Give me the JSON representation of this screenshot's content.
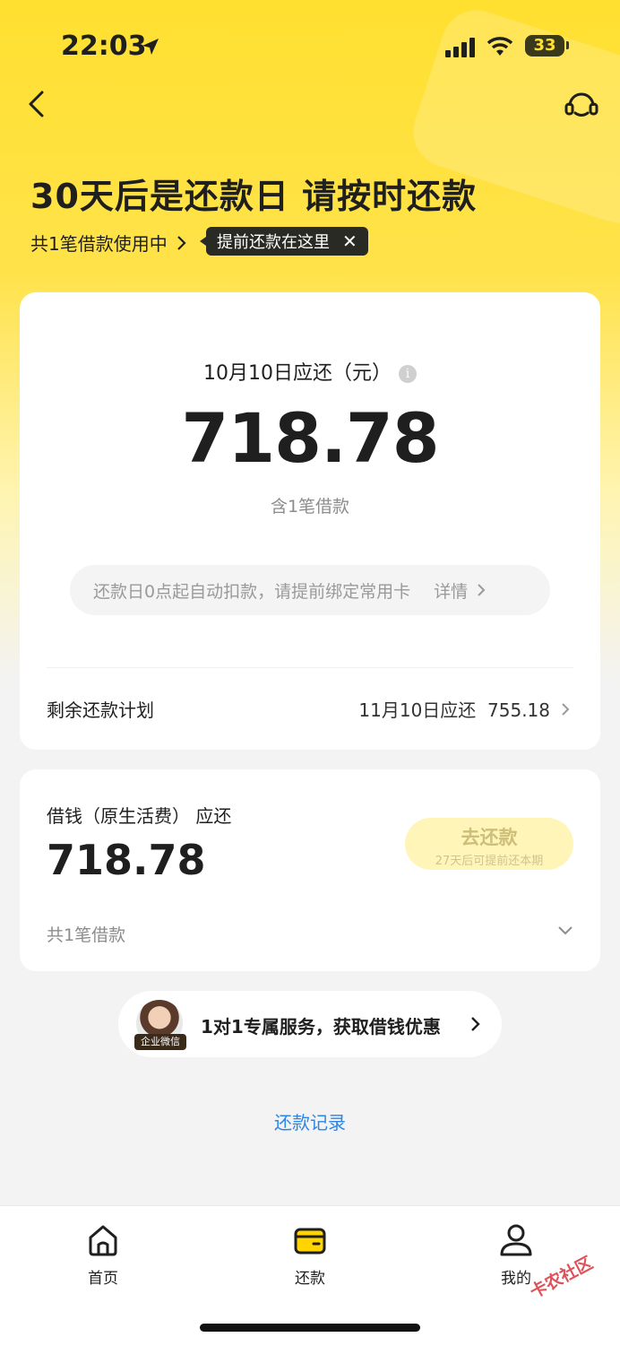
{
  "status_bar": {
    "time": "22:03",
    "battery": "33"
  },
  "header": {
    "headline": "30天后是还款日 请按时还款",
    "loan_count": "共1笔借款使用中",
    "tip": "提前还款在这里"
  },
  "due_card": {
    "label": "10月10日应还（元）",
    "amount": "718.78",
    "sub": "含1笔借款",
    "notice": "还款日0点起自动扣款，请提前绑定常用卡",
    "notice_detail": "详情",
    "plan_label": "剩余还款计划",
    "plan_value": "11月10日应还  755.18"
  },
  "loan_card": {
    "product_label": "借钱（原生活费） 应还",
    "amount": "718.78",
    "button_label": "去还款",
    "button_sub": "27天后可提前还本期",
    "count": "共1笔借款"
  },
  "service": {
    "avatar_tag": "企业微信",
    "text": "1对1专属服务，获取借钱优惠"
  },
  "records_link": "还款记录",
  "tabbar": {
    "home": "首页",
    "repay": "还款",
    "mine": "我的"
  },
  "watermark": "卡农社区",
  "colors": {
    "brand_yellow": "#ffe030",
    "link_blue": "#2b86e8"
  }
}
